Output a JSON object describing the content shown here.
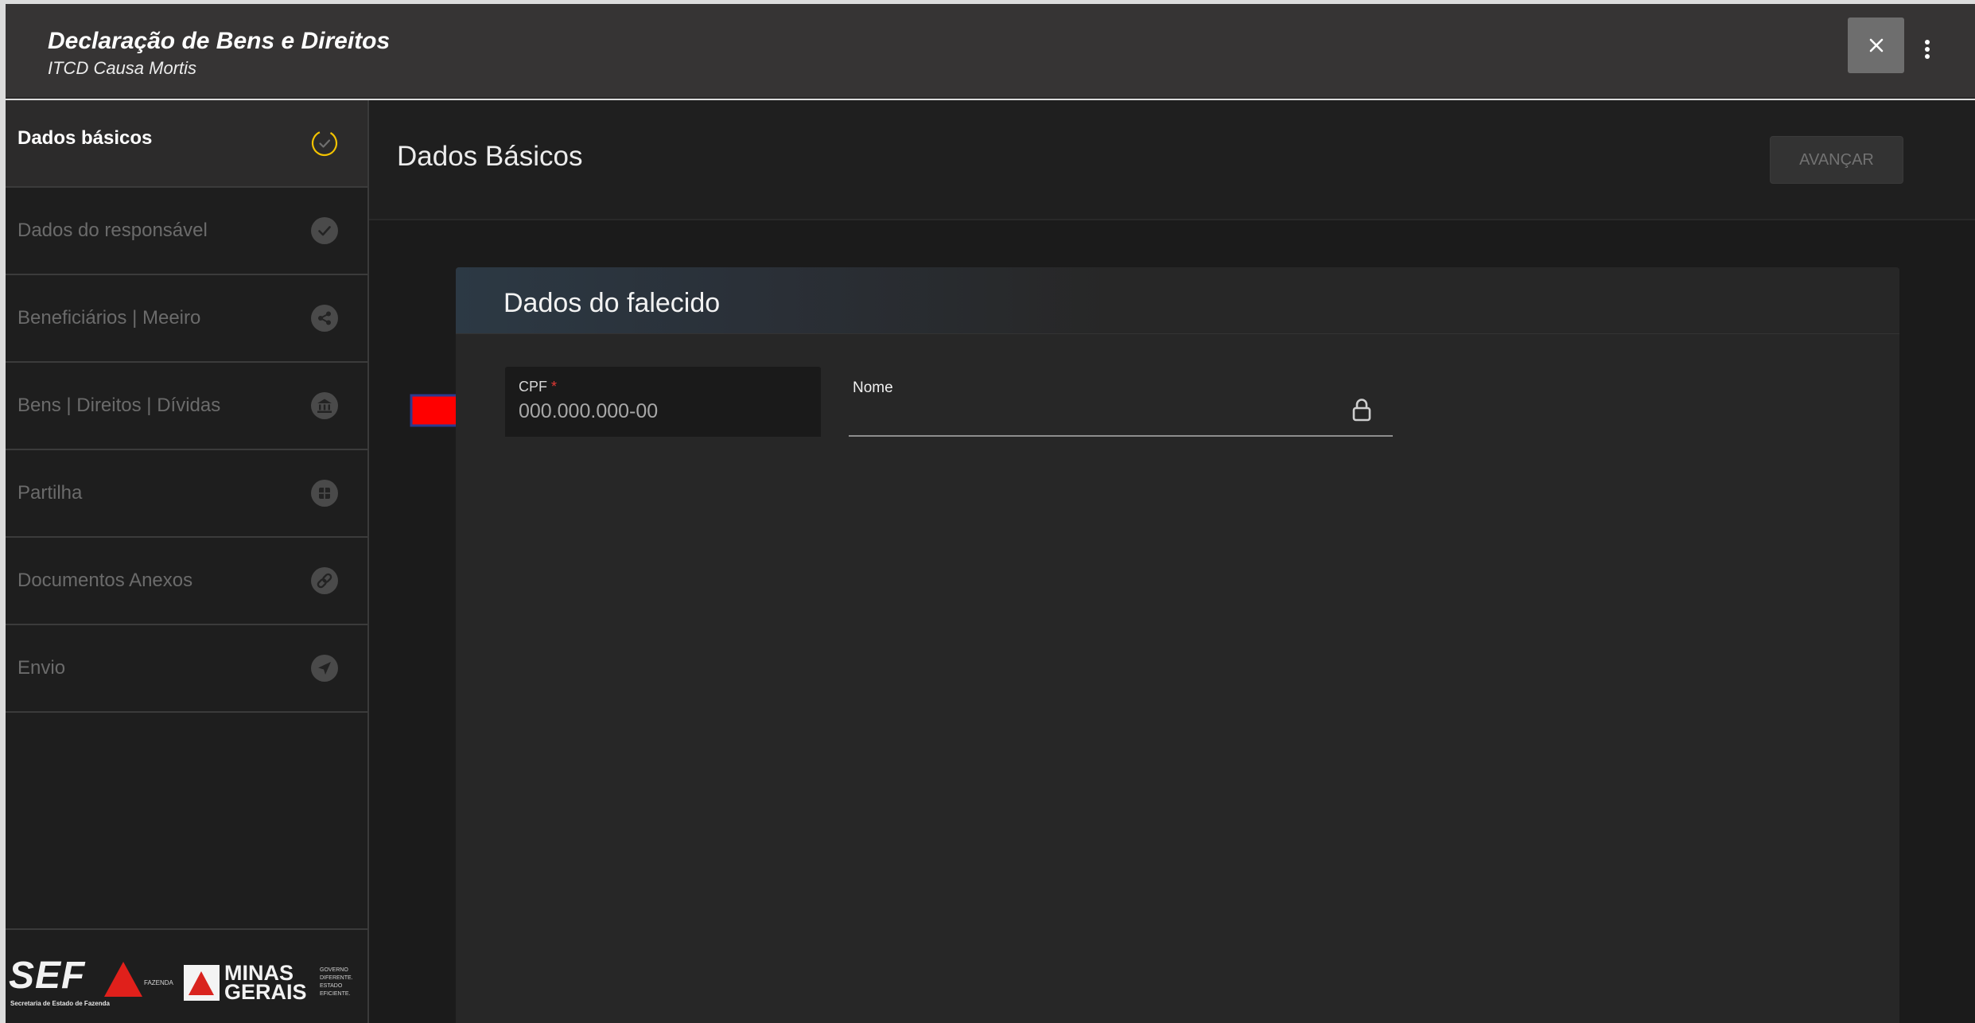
{
  "header": {
    "title": "Declaração de Bens e Direitos",
    "subtitle": "ITCD Causa Mortis",
    "close_icon": "close-icon",
    "menu_icon": "more-vertical-icon"
  },
  "sidebar": {
    "items": [
      {
        "label": "Dados básicos",
        "icon": "in-progress-check-icon",
        "active": true
      },
      {
        "label": "Dados do responsável",
        "icon": "check-circle-icon",
        "active": false
      },
      {
        "label": "Beneficiários | Meeiro",
        "icon": "share-icon",
        "active": false
      },
      {
        "label": "Bens | Direitos | Dívidas",
        "icon": "bank-icon",
        "active": false
      },
      {
        "label": "Partilha",
        "icon": "grid-icon",
        "active": false
      },
      {
        "label": "Documentos Anexos",
        "icon": "link-icon",
        "active": false
      },
      {
        "label": "Envio",
        "icon": "send-icon",
        "active": false
      }
    ],
    "footer": {
      "sef": "SEF",
      "sef_sub": "Secretaria de Estado de Fazenda",
      "fazenda": "FAZENDA",
      "minas": "MINAS",
      "gerais": "GERAIS",
      "gov_1": "GOVERNO",
      "gov_2": "DIFERENTE.",
      "gov_3": "ESTADO",
      "gov_4": "EFICIENTE."
    }
  },
  "main": {
    "title": "Dados Básicos",
    "advance_label": "AVANÇAR"
  },
  "card": {
    "title": "Dados do falecido",
    "cpf": {
      "label": "CPF",
      "required": "*",
      "placeholder": "000.000.000-00"
    },
    "nome": {
      "label": "Nome",
      "icon": "lock-icon"
    }
  },
  "colors": {
    "accent": "#f2c200",
    "required": "#e53935",
    "annotation_arrow": "#ff0000"
  }
}
